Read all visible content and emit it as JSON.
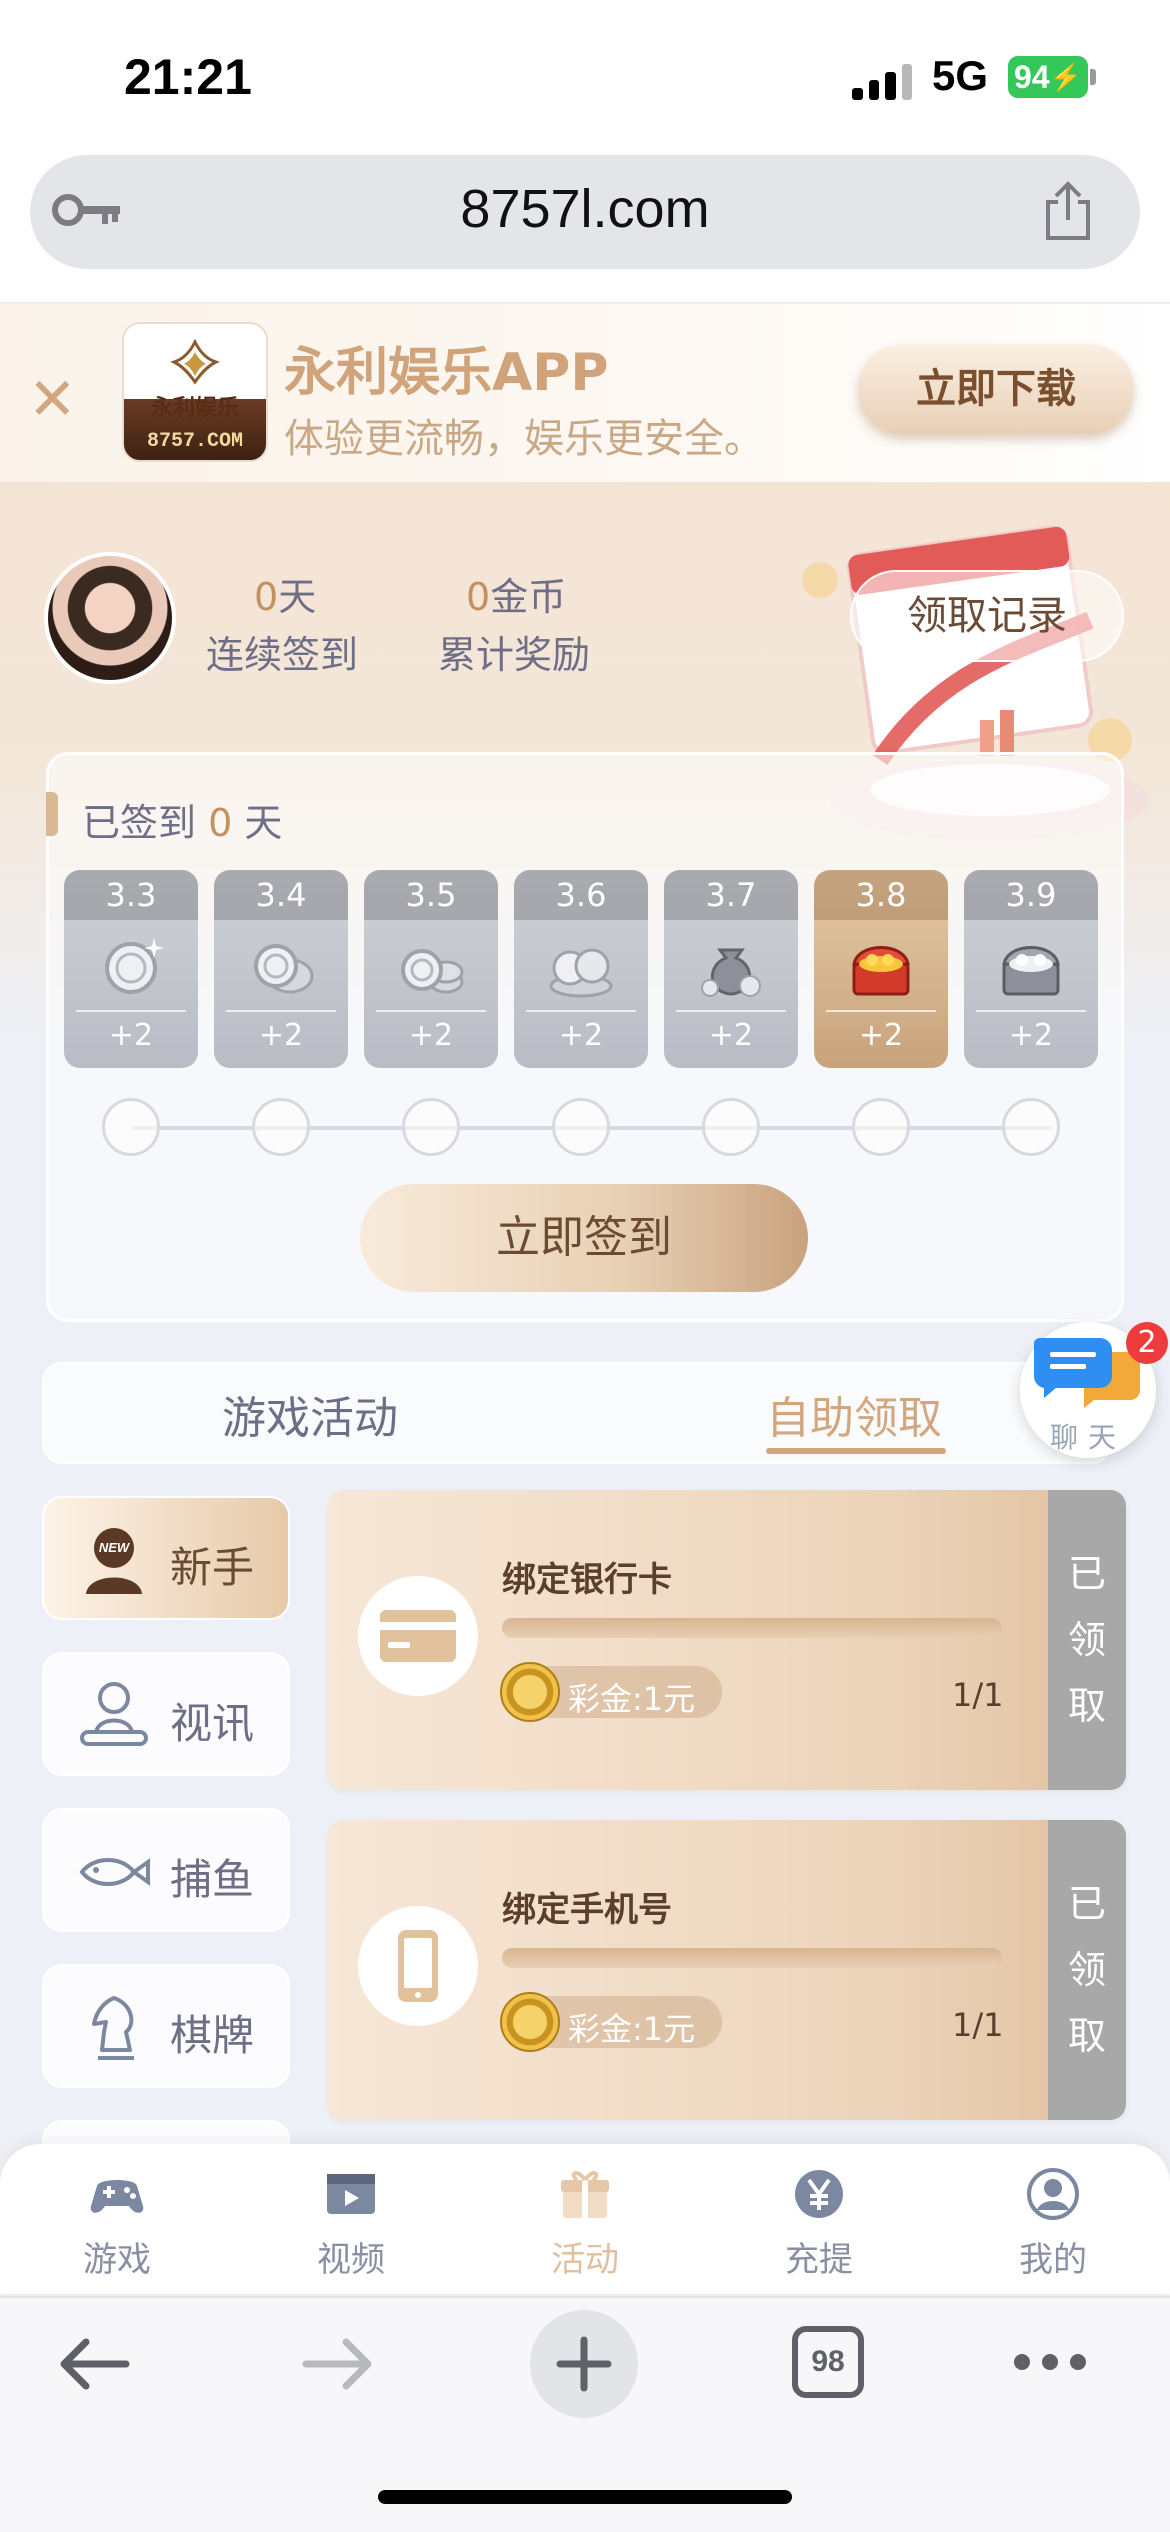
{
  "status_bar": {
    "time": "21:21",
    "network": "5G",
    "battery": "94"
  },
  "browser": {
    "url": "8757l.com"
  },
  "app_banner": {
    "logo_name": "永利娱乐",
    "logo_url": "8757.COM",
    "title": "永利娱乐APP",
    "subtitle": "体验更流畅，娱乐更安全。",
    "download_label": "立即下载"
  },
  "profile": {
    "streak_value": "0",
    "streak_unit": "天",
    "streak_label": "连续签到",
    "coins_value": "0",
    "coins_unit": "金币",
    "coins_label": "累计奖励",
    "records_label": "领取记录"
  },
  "signin": {
    "signed_prefix": "已签到",
    "signed_count": "0",
    "signed_suffix": "天",
    "days": [
      {
        "date": "3.3",
        "reward": "+2",
        "icon": "single-silver-coin-icon"
      },
      {
        "date": "3.4",
        "reward": "+2",
        "icon": "silver-coins-icon"
      },
      {
        "date": "3.5",
        "reward": "+2",
        "icon": "silver-coin-stack-icon"
      },
      {
        "date": "3.6",
        "reward": "+2",
        "icon": "silver-coin-pile-icon"
      },
      {
        "date": "3.7",
        "reward": "+2",
        "icon": "money-bag-icon"
      },
      {
        "date": "3.8",
        "reward": "+2",
        "icon": "gold-chest-icon"
      },
      {
        "date": "3.9",
        "reward": "+2",
        "icon": "silver-chest-icon"
      }
    ],
    "button_label": "立即签到"
  },
  "tabs": [
    {
      "label": "游戏活动",
      "active": false
    },
    {
      "label": "自助领取",
      "active": true
    }
  ],
  "chat": {
    "label": "聊天",
    "badge": "2"
  },
  "categories": [
    {
      "label": "新手",
      "icon": "new-user-icon",
      "active": true
    },
    {
      "label": "视讯",
      "icon": "live-dealer-icon",
      "active": false
    },
    {
      "label": "捕鱼",
      "icon": "fish-icon",
      "active": false
    },
    {
      "label": "棋牌",
      "icon": "chess-knight-icon",
      "active": false
    }
  ],
  "tasks": [
    {
      "title": "绑定银行卡",
      "reward": "彩金:1元",
      "progress": "1/1",
      "progress_fraction": 1.0,
      "status": [
        "已",
        "领",
        "取"
      ],
      "icon": "bank-card-icon"
    },
    {
      "title": "绑定手机号",
      "reward": "彩金:1元",
      "progress": "1/1",
      "progress_fraction": 1.0,
      "status": [
        "已",
        "领",
        "取"
      ],
      "icon": "phone-icon"
    }
  ],
  "app_nav": [
    {
      "label": "游戏",
      "icon": "gamepad-icon",
      "active": false
    },
    {
      "label": "视频",
      "icon": "video-icon",
      "active": false
    },
    {
      "label": "活动",
      "icon": "gift-icon",
      "active": true
    },
    {
      "label": "充提",
      "icon": "yuan-icon",
      "active": false
    },
    {
      "label": "我的",
      "icon": "user-icon",
      "active": false
    }
  ],
  "safari_toolbar": {
    "tab_count": "98"
  },
  "colors": {
    "accent_gold": "#d2a77f",
    "text_muted": "#6e6e86",
    "badge_red": "#ee3b3b",
    "status_gray": "#a8a8a8"
  }
}
